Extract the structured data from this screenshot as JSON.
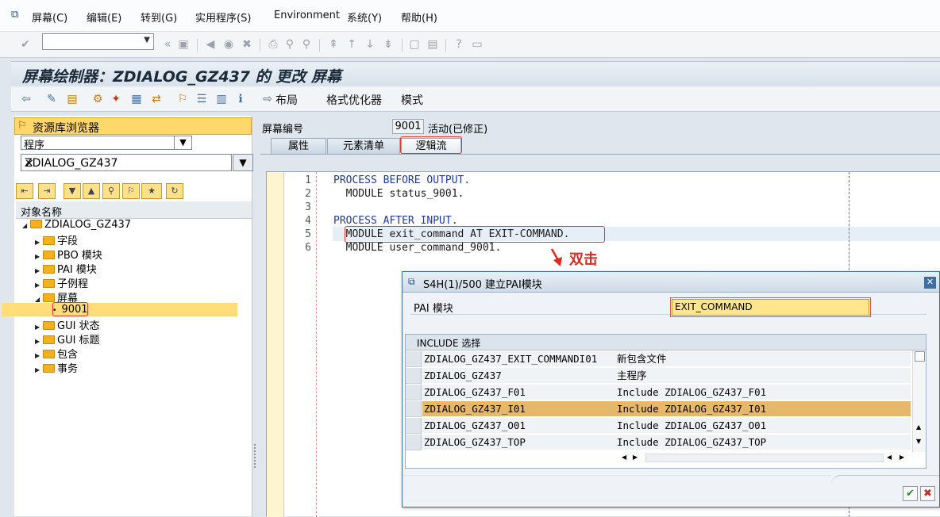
{
  "menu": [
    "屏幕(C)",
    "编辑(E)",
    "转到(G)",
    "实用程序(S)",
    "Environment",
    "系统(Y)",
    "帮助(H)"
  ],
  "title": "屏幕绘制器：ZDIALOG_GZ437 的 更改 屏幕",
  "toolbar2": {
    "layout_label": "布局",
    "format_label": "格式优化器",
    "mode_label": "模式"
  },
  "left": {
    "repo_title": "资源库浏览器",
    "object_type": "程序",
    "object_name": "ZDIALOG_GZ437",
    "column_header": "对象名称",
    "tree": {
      "root": "ZDIALOG_GZ437",
      "items": [
        "字段",
        "PBO 模块",
        "PAI 模块",
        "子例程",
        "屏幕"
      ],
      "selected_screen": "9001",
      "after": [
        "GUI 状态",
        "GUI 标题",
        "包含",
        "事务"
      ]
    }
  },
  "screen": {
    "label": "屏幕编号",
    "number": "9001",
    "status": "活动(已修正)"
  },
  "tabs": [
    "属性",
    "元素清单",
    "逻辑流"
  ],
  "editor": {
    "line_numbers": [
      "1",
      "2",
      "3",
      "4",
      "5",
      "6"
    ],
    "lines": [
      "PROCESS BEFORE OUTPUT.",
      "  MODULE status_9001.",
      "",
      "PROCESS AFTER INPUT.",
      "  MODULE exit_command AT EXIT-COMMAND.",
      "  MODULE user_command_9001."
    ]
  },
  "annotation": "双击",
  "dialog": {
    "title": "S4H(1)/500 建立PAI模块",
    "pai_label": "PAI 模块",
    "pai_value": "EXIT_COMMAND",
    "include_header": "INCLUDE 选择",
    "includes": [
      {
        "name": "ZDIALOG_GZ437_EXIT_COMMANDI01",
        "desc": "新包含文件"
      },
      {
        "name": "ZDIALOG_GZ437",
        "desc": "主程序"
      },
      {
        "name": "ZDIALOG_GZ437_F01",
        "desc": "Include ZDIALOG_GZ437_F01"
      },
      {
        "name": "ZDIALOG_GZ437_I01",
        "desc": "Include ZDIALOG_GZ437_I01"
      },
      {
        "name": "ZDIALOG_GZ437_O01",
        "desc": "Include ZDIALOG_GZ437_O01"
      },
      {
        "name": "ZDIALOG_GZ437_TOP",
        "desc": "Include ZDIALOG_GZ437_TOP"
      }
    ],
    "ok_icon": "check-icon",
    "cancel_icon": "cancel-icon"
  },
  "colors": {
    "highlight_red": "#e0382e",
    "selected_row": "#e6b86c",
    "code_blue": "#1f3a9e"
  }
}
